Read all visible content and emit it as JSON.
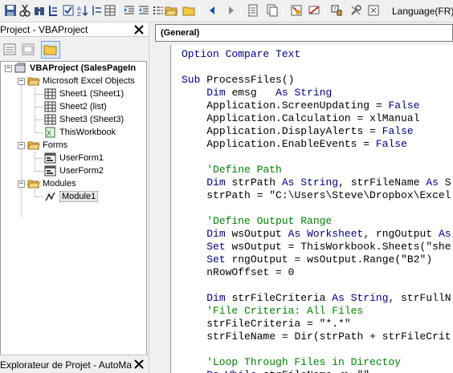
{
  "toolbar": {
    "language_label": "Language(FR)",
    "icons": [
      "save-icon",
      "cut-icon",
      "binoculars-icon",
      "sub-icon",
      "check-icon",
      "sort-icon",
      "indent-icon",
      "outdent-icon",
      "list-icon",
      "open-folder-icon",
      "folder-icon",
      "back-icon",
      "forward-icon",
      "file-icon",
      "copy-icon",
      "object-browser-icon",
      "clear-icon",
      "project-icon",
      "tools-icon",
      "settings-icon"
    ]
  },
  "project_pane": {
    "title": "Project - VBAProject",
    "tree": {
      "root": "VBAProject (SalesPageIn",
      "excel_objects_folder": "Microsoft Excel Objects",
      "sheets": [
        "Sheet1 (Sheet1)",
        "Sheet2 (list)",
        "Sheet3 (Sheet3)"
      ],
      "workbook": "ThisWorkbook",
      "forms_folder": "Forms",
      "forms": [
        "UserForm1",
        "UserForm2"
      ],
      "modules_folder": "Modules",
      "modules": [
        "Module1"
      ]
    }
  },
  "properties_pane": {
    "title": "Explorateur de Projet - AutoMa"
  },
  "code_window": {
    "object_combo": "(General)",
    "lines": [
      "Option Compare Text",
      "",
      "Sub ProcessFiles()",
      "    Dim emsg   As String",
      "    Application.ScreenUpdating = False",
      "    Application.Calculation = xlManual",
      "    Application.DisplayAlerts = False",
      "    Application.EnableEvents = False",
      "",
      "    'Define Path",
      "    Dim strPath As String, strFileName As S",
      "    strPath = \"C:\\Users\\Steve\\Dropbox\\Excel",
      "",
      "    'Define Output Range",
      "    Dim wsOutput As Worksheet, rngOutput As",
      "    Set wsOutput = ThisWorkbook.Sheets(\"she",
      "    Set rngOutput = wsOutput.Range(\"B2\")",
      "    nRowOffset = 0",
      "",
      "    Dim strFileCriteria As String, strFullN",
      "    'File Criteria: All Files",
      "    strFileCriteria = \"*.*\"",
      "    strFileName = Dir(strPath + strFileCrit",
      "",
      "    'Loop Through Files in Directoy",
      "    Do While strFileName <> \"\""
    ]
  }
}
